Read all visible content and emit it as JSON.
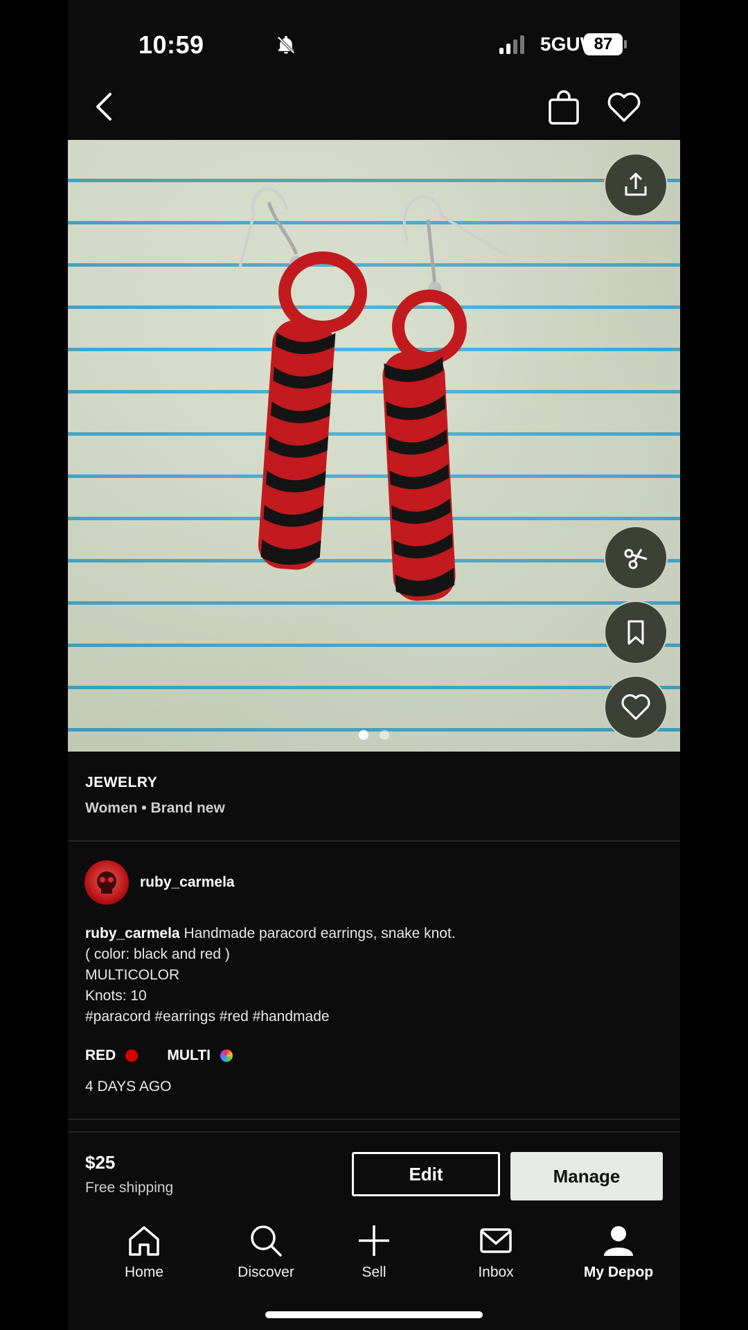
{
  "status_bar": {
    "time": "10:59",
    "network": "5GUW",
    "battery": "87"
  },
  "listing": {
    "category": "JEWELRY",
    "subinfo": "Women • Brand new",
    "image_pages": 2,
    "active_page": 1
  },
  "seller": {
    "username": "ruby_carmela"
  },
  "description": {
    "username": "ruby_carmela",
    "first_line": "Handmade paracord earrings, snake knot.",
    "line2": "( color: black and red )",
    "line3": "MULTICOLOR",
    "line4": "Knots: 10",
    "line5": "#paracord #earrings #red #handmade"
  },
  "colors": [
    {
      "label": "RED",
      "swatch": "#d60000"
    },
    {
      "label": "MULTI",
      "swatch": "multicolor"
    }
  ],
  "posted": "4 DAYS AGO",
  "purchase": {
    "price": "$25",
    "shipping": "Free shipping",
    "edit_label": "Edit",
    "manage_label": "Manage"
  },
  "tabs": [
    {
      "label": "Home",
      "icon": "home-icon"
    },
    {
      "label": "Discover",
      "icon": "search-icon"
    },
    {
      "label": "Sell",
      "icon": "plus-icon"
    },
    {
      "label": "Inbox",
      "icon": "mail-icon"
    },
    {
      "label": "My Depop",
      "icon": "profile-icon",
      "active": true
    }
  ]
}
